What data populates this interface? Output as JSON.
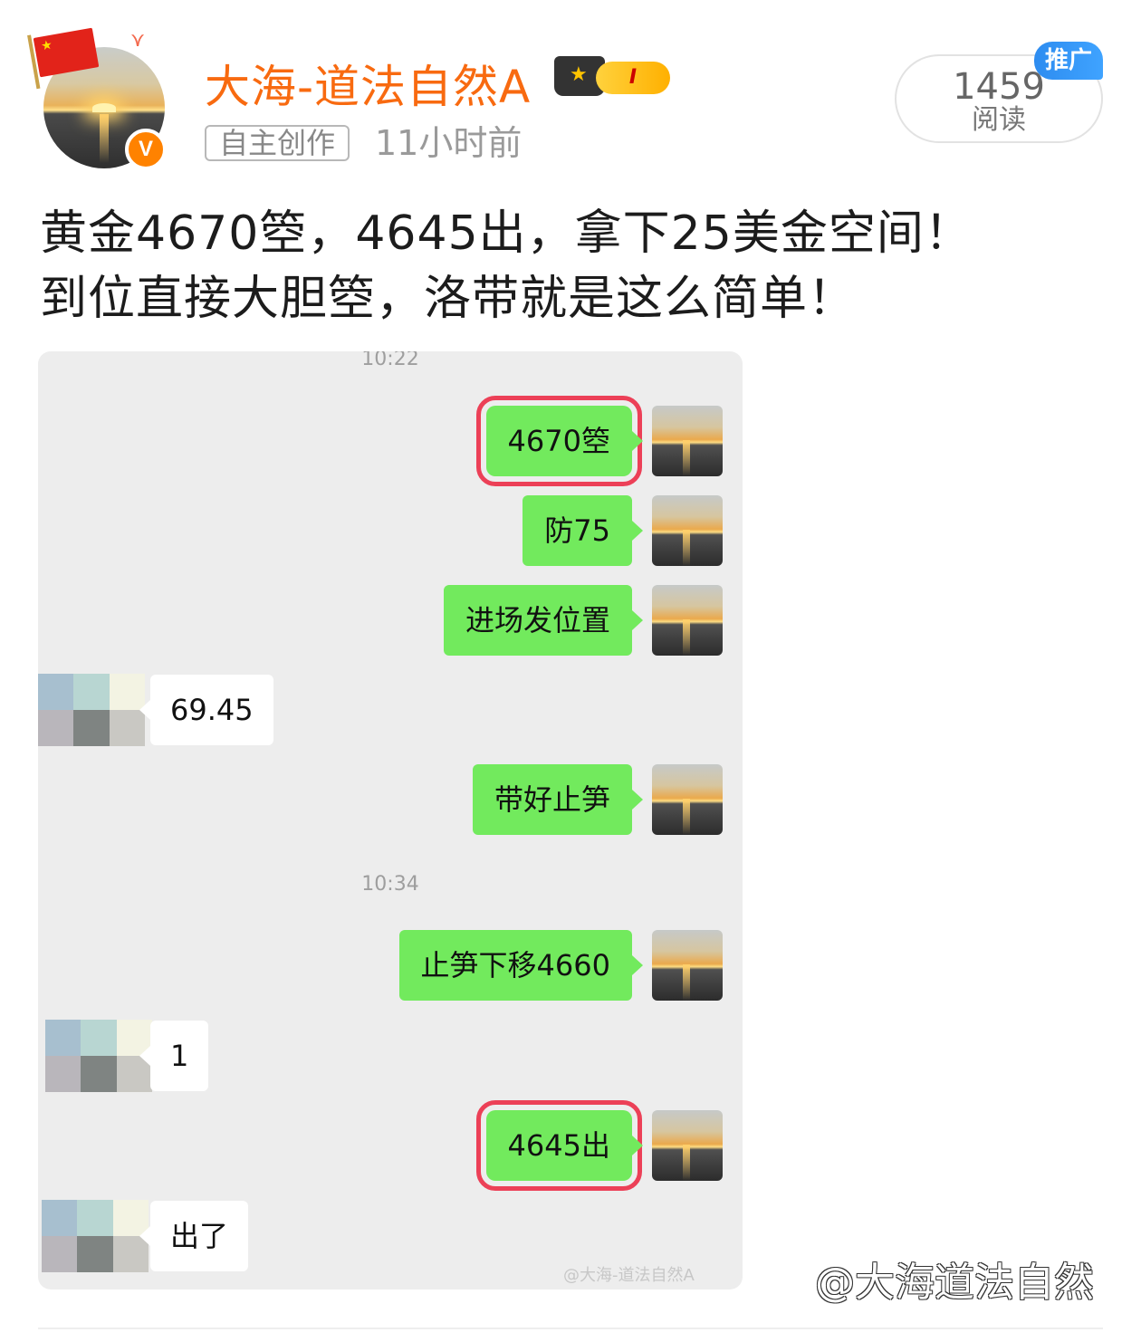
{
  "author": {
    "name": "大海-道法自然A",
    "verified_badge": "V",
    "level_badge": "I",
    "tag": "自主创作",
    "time": "11小时前"
  },
  "reads": {
    "count": "1459",
    "label": "阅读",
    "promo": "推广"
  },
  "post": {
    "line1": "黄金4670箜，4645出，拿下25美金空间！",
    "line2": "到位直接大胆箜，洛带就是这么简单！"
  },
  "chat": {
    "timestamps": [
      "10:22",
      "10:34"
    ],
    "messages": [
      {
        "from": "me",
        "text": "4670箜",
        "highlight": true
      },
      {
        "from": "me",
        "text": "防75",
        "highlight": false
      },
      {
        "from": "me",
        "text": "进场发位置",
        "highlight": false
      },
      {
        "from": "them",
        "text": "69.45"
      },
      {
        "from": "me",
        "text": "带好止笋",
        "highlight": false
      },
      {
        "from": "me",
        "text": "止笋下移4660",
        "highlight": false
      },
      {
        "from": "them",
        "text": "1"
      },
      {
        "from": "me",
        "text": "4645出",
        "highlight": true
      },
      {
        "from": "them",
        "text": "出了"
      }
    ],
    "watermark": "@大海-道法自然A"
  },
  "watermark_outer": "@大海道法自然",
  "colors": {
    "accent": "#f86a10",
    "bubble_me": "#72ea5d",
    "highlight": "#ec4057",
    "promo": "#2d8cf0"
  }
}
